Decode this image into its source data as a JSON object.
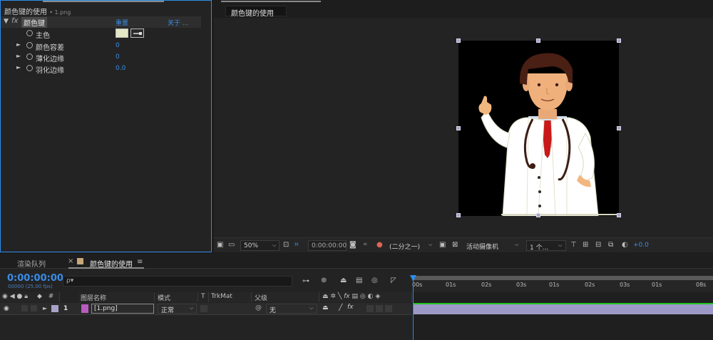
{
  "effect_panel": {
    "title": "颜色键的使用",
    "file": "• 1.png",
    "effect_name": "颜色键",
    "fx_label": "fx",
    "reset_label": "重置",
    "about_label": "关于 ...",
    "properties": [
      {
        "label": "主色",
        "value": ""
      },
      {
        "label": "颜色容差",
        "value": "0"
      },
      {
        "label": "薄化边缘",
        "value": "0"
      },
      {
        "label": "羽化边缘",
        "value": "0.0"
      }
    ],
    "key_color": "#e4e7c6"
  },
  "composition": {
    "tab": "颜色键的使用",
    "zoom": "50%",
    "timecode": "0:00:00:00",
    "resolution": "(二分之一)",
    "camera": "活动摄像机",
    "views": "1 个...",
    "exposure": "+0.0"
  },
  "timeline": {
    "tabs": [
      "渲染队列",
      "颜色键的使用"
    ],
    "close_mark": "×",
    "menu_mark": "≡",
    "timecode": "0:00:00:00",
    "timecode_sub": "00000 (25.00 fps)",
    "search_icon_glyph": "ρ▾",
    "columns": {
      "num": "#",
      "layer_name": "图层名称",
      "mode": "模式",
      "t": "T",
      "trkmat": "TrkMat",
      "parent": "父级"
    },
    "layer": {
      "index": "1",
      "name": "[1.png]",
      "mode": "正常",
      "parent": "无"
    },
    "ruler_ticks": [
      "00s",
      "01s",
      "02s",
      "03s",
      "01s",
      "02s",
      "03s",
      "01s",
      "08s"
    ],
    "accent": "#2d8ceb",
    "track_color": "#9d99c7"
  }
}
